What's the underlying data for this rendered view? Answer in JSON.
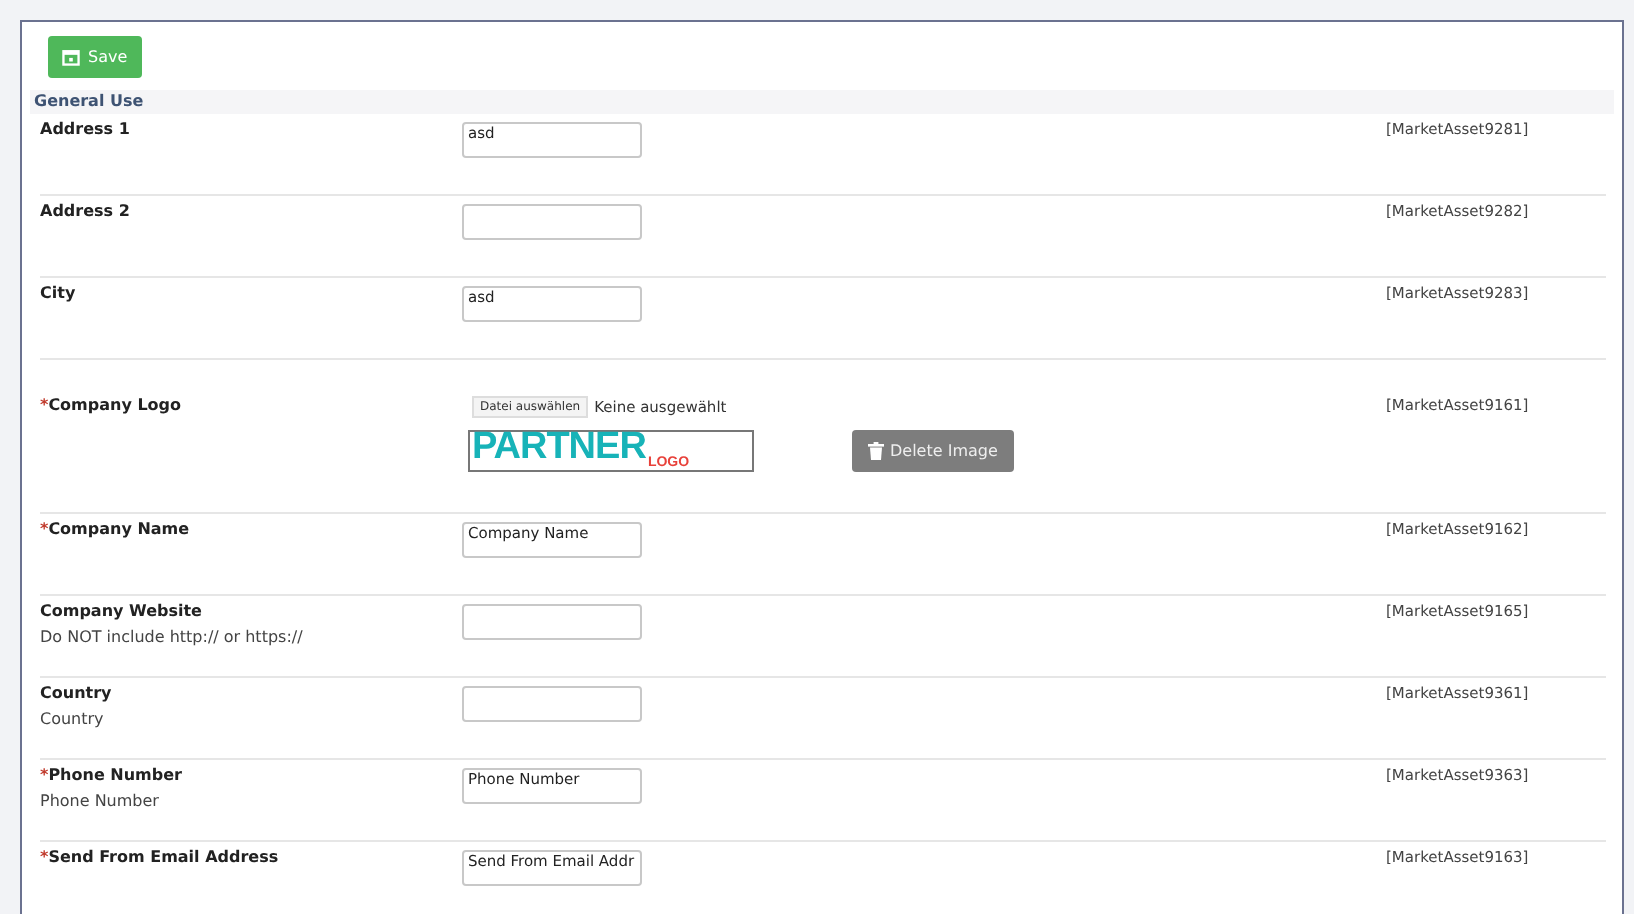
{
  "toolbar": {
    "save_button": "Save"
  },
  "section": {
    "title": "General Use"
  },
  "fields": [
    {
      "kind": "text",
      "label": "Address 1",
      "value": "asd",
      "asset": "[MarketAsset9281]"
    },
    {
      "kind": "text",
      "label": "Address 2",
      "asset": "[MarketAsset9282]"
    },
    {
      "kind": "text",
      "label": "City",
      "value": "asd",
      "asset": "[MarketAsset9283]"
    },
    {
      "kind": "file",
      "label": "Company Logo",
      "required_mark": "*",
      "file_button": "Datei auswählen",
      "file_status": "Keine ausgewählt",
      "logo": {
        "main": "PARTNER",
        "sub": "LOGO"
      },
      "delete_button": "Delete Image",
      "asset": "[MarketAsset9161]"
    },
    {
      "kind": "text",
      "label": "Company Name",
      "required_mark": "*",
      "value": "Company Name",
      "asset": "[MarketAsset9162]"
    },
    {
      "kind": "text",
      "label": "Company Website",
      "hint": "Do NOT include http:// or https://",
      "asset": "[MarketAsset9165]"
    },
    {
      "kind": "text",
      "label": "Country",
      "hint": "Country",
      "asset": "[MarketAsset9361]"
    },
    {
      "kind": "text",
      "label": "Phone Number",
      "required_mark": "*",
      "hint": "Phone Number",
      "value": "Phone Number",
      "asset": "[MarketAsset9363]"
    },
    {
      "kind": "text",
      "label": "Send From Email Address",
      "required_mark": "*",
      "value": "Send From Email Addr",
      "asset": "[MarketAsset9163]"
    }
  ]
}
